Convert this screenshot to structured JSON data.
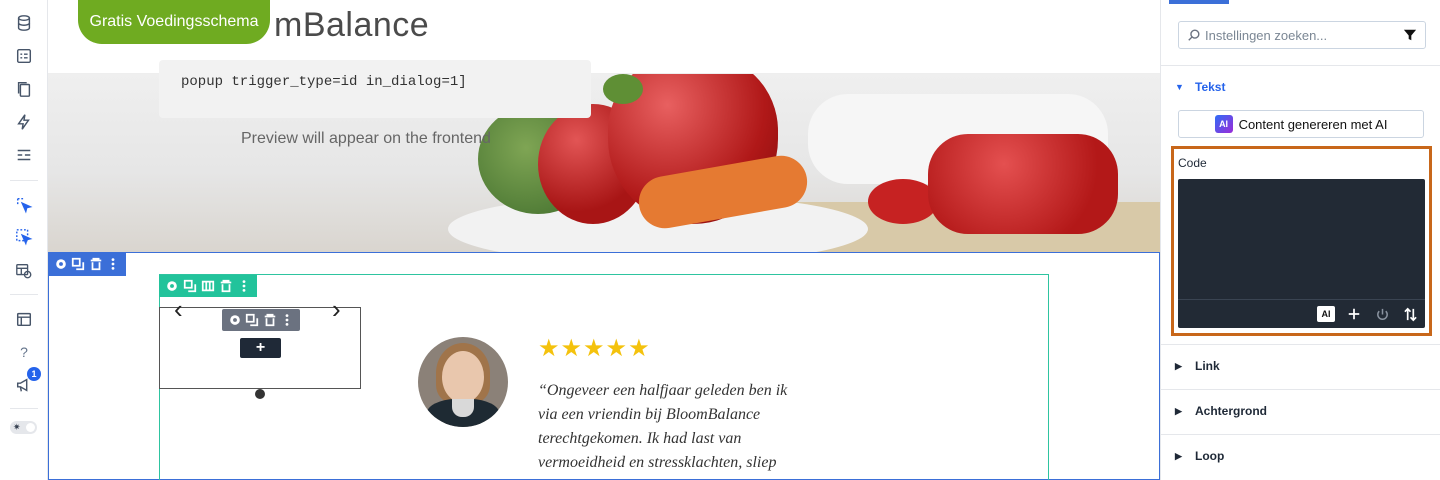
{
  "sidebar": {
    "icons": [
      "database-icon",
      "form-icon",
      "copy-icon",
      "lightning-icon",
      "layout-icon",
      "select-icon",
      "multi-select-icon",
      "template-preview-icon",
      "layers-icon",
      "help-icon",
      "megaphone-icon"
    ],
    "help_label": "?",
    "notification_count": "1",
    "theme_toggle": "light"
  },
  "header": {
    "cta_label": "Gratis Voedingsschema",
    "logo_text": "mBalance",
    "brand_color": "#6fab21"
  },
  "hero": {
    "shortcode_text": "popup trigger_type=id in_dialog=1]",
    "preview_text": "Preview will appear on the frontend"
  },
  "testimonial": {
    "stars": "★★★★★",
    "star_rating": 5,
    "quote": "“Ongeveer een halfjaar geleden ben ik via een vriendin bij BloomBalance terechtgekomen. Ik had last van vermoeidheid en stressklachten, sliep",
    "add_label": "+",
    "prev_arrow": "‹",
    "next_arrow": "›"
  },
  "panel": {
    "search_placeholder": "Instellingen zoeken...",
    "sections": {
      "tekst": "Tekst",
      "link": "Link",
      "achtergrond": "Achtergrond",
      "loop": "Loop"
    },
    "ai_button_label": "Content genereren met AI",
    "ai_badge": "AI",
    "code_label": "Code",
    "editor_ai": "AI",
    "accent_color": "#2563eb",
    "highlight_color": "#c8671a"
  }
}
